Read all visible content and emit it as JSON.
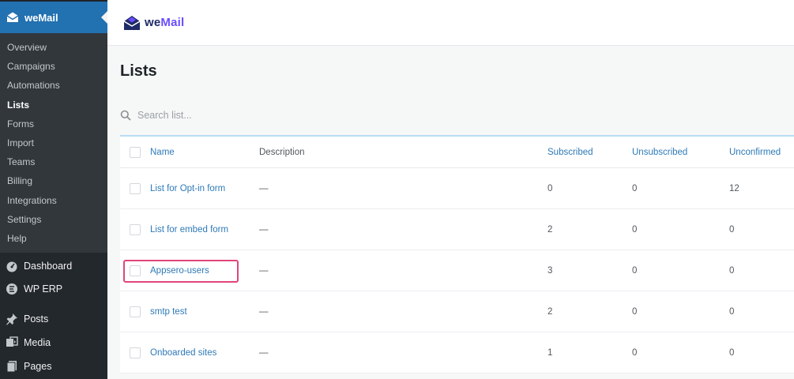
{
  "sidebar": {
    "brand": "weMail",
    "submenu": [
      "Overview",
      "Campaigns",
      "Automations",
      "Lists",
      "Forms",
      "Import",
      "Teams",
      "Billing",
      "Integrations",
      "Settings",
      "Help"
    ],
    "current": "Lists",
    "main_items": [
      {
        "label": "Dashboard",
        "icon": "dashboard-icon"
      },
      {
        "label": "WP ERP",
        "icon": "erp-icon"
      },
      {
        "label": "Posts",
        "icon": "pin-icon"
      },
      {
        "label": "Media",
        "icon": "media-icon"
      },
      {
        "label": "Pages",
        "icon": "pages-icon"
      }
    ]
  },
  "header": {
    "logo_we": "we",
    "logo_mail": "Mail"
  },
  "page": {
    "title": "Lists",
    "search_placeholder": "Search list..."
  },
  "table": {
    "columns": [
      "Name",
      "Description",
      "Subscribed",
      "Unsubscribed",
      "Unconfirmed"
    ],
    "rows": [
      {
        "name": "List for Opt-in form",
        "description": "—",
        "subscribed": "0",
        "unsubscribed": "0",
        "unconfirmed": "12"
      },
      {
        "name": "List for embed form",
        "description": "—",
        "subscribed": "2",
        "unsubscribed": "0",
        "unconfirmed": "0"
      },
      {
        "name": "Appsero-users",
        "description": "—",
        "subscribed": "3",
        "unsubscribed": "0",
        "unconfirmed": "0"
      },
      {
        "name": "smtp test",
        "description": "—",
        "subscribed": "2",
        "unsubscribed": "0",
        "unconfirmed": "0"
      },
      {
        "name": "Onboarded sites",
        "description": "—",
        "subscribed": "1",
        "unsubscribed": "0",
        "unconfirmed": "0"
      }
    ]
  },
  "colors": {
    "sidebar_bg": "#23282d",
    "active_bg": "#2271b1",
    "link": "#2e7ab8",
    "highlight": "#e0457b"
  }
}
